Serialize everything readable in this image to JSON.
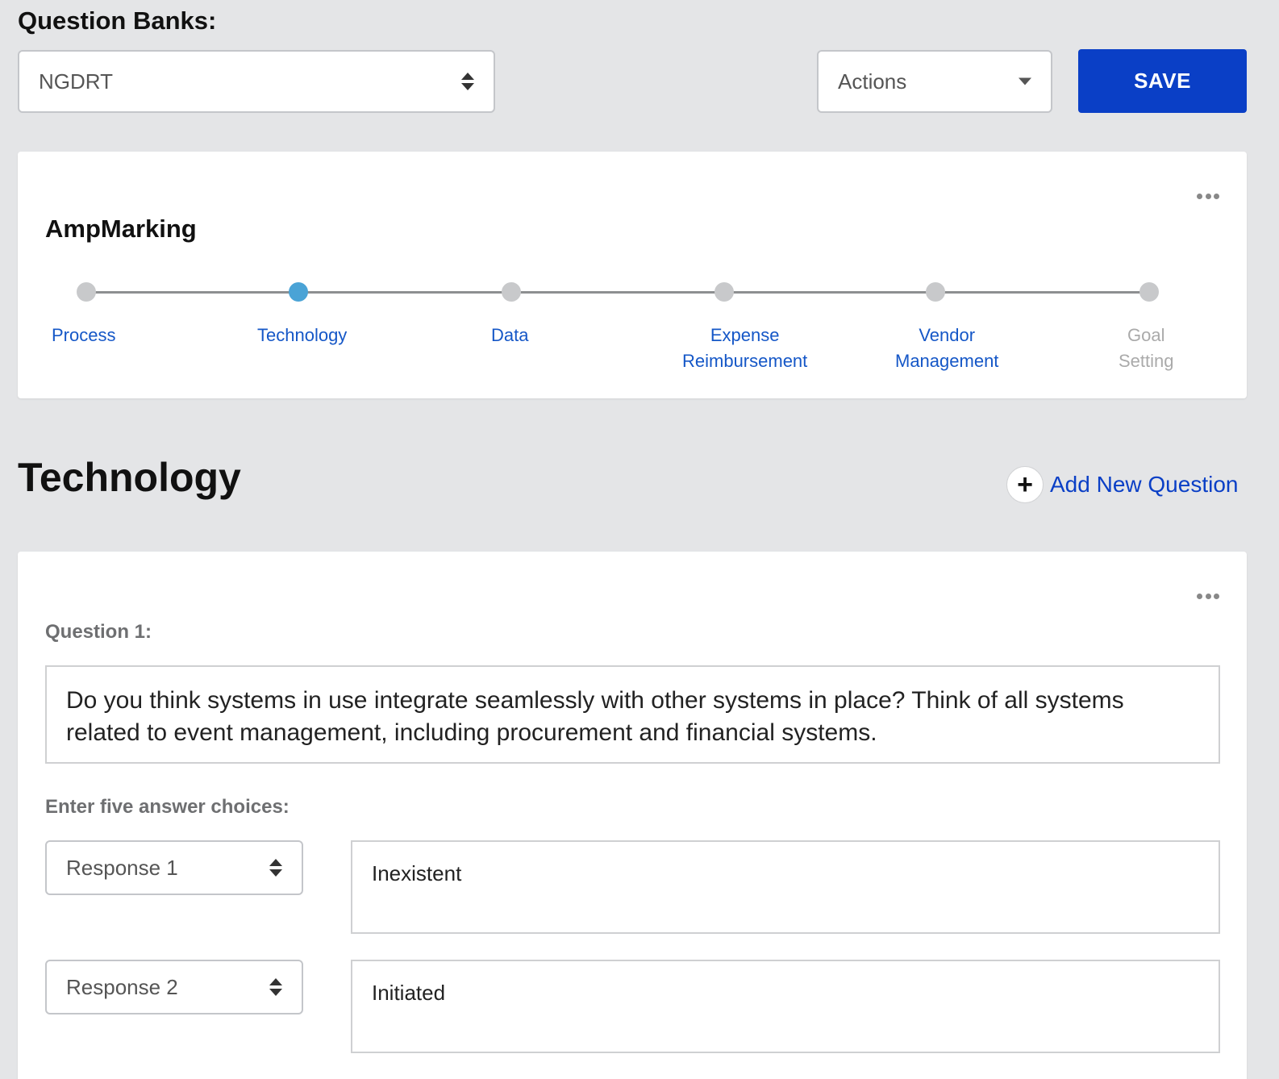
{
  "header": {
    "question_banks_label": "Question Banks:",
    "bank_select_value": "NGDRT",
    "actions_label": "Actions",
    "save_label": "SAVE"
  },
  "bank_card": {
    "title": "AmpMarking",
    "active_step": "Technology",
    "steps": [
      {
        "label": "Process"
      },
      {
        "label": "Technology"
      },
      {
        "label": "Data"
      },
      {
        "label": "Expense\nReimbursement"
      },
      {
        "label": "Vendor\nManagement"
      },
      {
        "label": "Goal\nSetting"
      }
    ]
  },
  "section": {
    "title": "Technology",
    "add_question_label": "Add New Question"
  },
  "question": {
    "label": "Question 1:",
    "text": "Do you think systems in use integrate seamlessly with other systems in place? Think of all systems related to event management, including procurement and financial systems.",
    "answers_label": "Enter five answer choices:",
    "responses": [
      {
        "select": "Response 1",
        "value": "Inexistent"
      },
      {
        "select": "Response 2",
        "value": "Initiated"
      }
    ]
  },
  "colors": {
    "background": "#e4e5e7",
    "primary_button": "#0a3fc6",
    "link": "#1557c7",
    "active_step": "#4aa3d6"
  }
}
